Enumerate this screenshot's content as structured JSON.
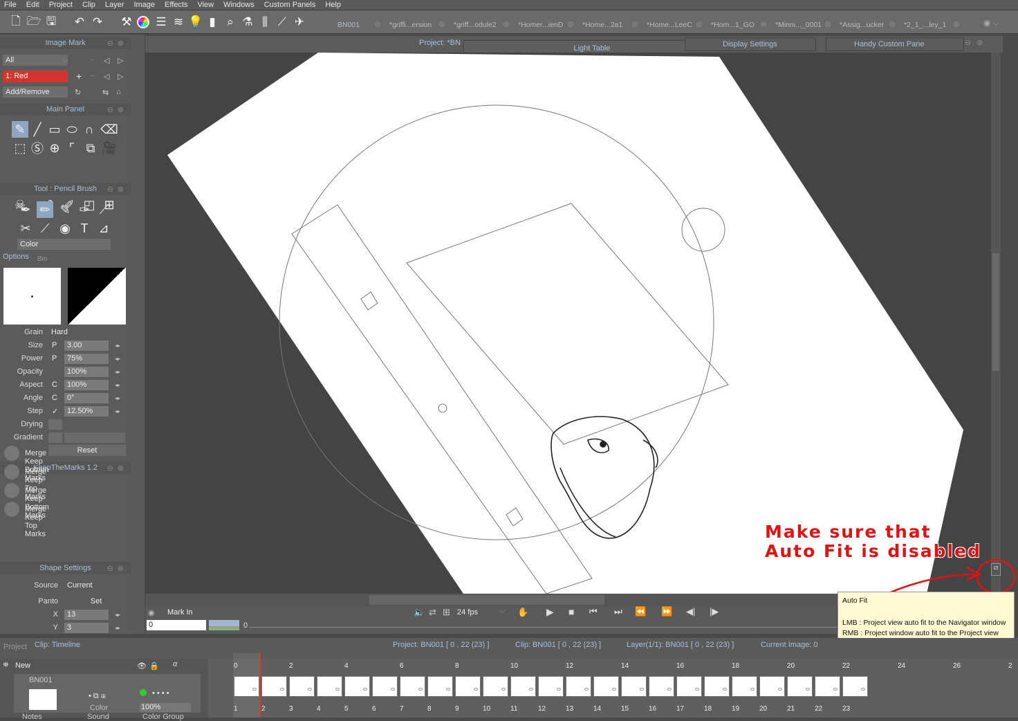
{
  "menu": [
    "File",
    "Edit",
    "Project",
    "Clip",
    "Layer",
    "Image",
    "Effects",
    "View",
    "Windows",
    "Custom Panels",
    "Help"
  ],
  "tabs": [
    {
      "label": "BN001",
      "active": true
    },
    {
      "label": "*griffi...ersion"
    },
    {
      "label": "*griff...odule2"
    },
    {
      "label": "*Homer...ienD"
    },
    {
      "label": "*Home...2a1"
    },
    {
      "label": "*Home...LeeC"
    },
    {
      "label": "*Hom...1_GO"
    },
    {
      "label": "*Minni..._0001"
    },
    {
      "label": "*Assig...ucker"
    },
    {
      "label": "*2_1_...ley_1"
    }
  ],
  "image_mark": {
    "title": "Image Mark",
    "filter": "All",
    "mark": "1: Red",
    "action": "Add/Remove",
    "mark_color": "#d2342e"
  },
  "main_panel": {
    "title": "Main Panel"
  },
  "tool_panel": {
    "title": "Tool : Pencil Brush",
    "color_label": "Color",
    "tab_options": "Options",
    "tab_bin": "Bin"
  },
  "brush": {
    "grain_label": "Grain",
    "grain": "Hard",
    "size_label": "Size",
    "size_flag": "P",
    "size": "3.00",
    "power_label": "Power",
    "power_flag": "P",
    "power": "75%",
    "opacity_label": "Opacity",
    "opacity": "100%",
    "aspect_label": "Aspect",
    "aspect_flag": "C",
    "aspect": "100%",
    "angle_label": "Angle",
    "angle_flag": "C",
    "angle": "0°",
    "step_label": "Step",
    "step": "12.50%",
    "drying_label": "Drying",
    "gradient_label": "Gradient",
    "reset_label": "Reset"
  },
  "keepthemarks": {
    "title": "KeepTheMarks 1.2",
    "items": [
      "Merge Keep Bottom Marks",
      "Merge Keep Top Marks",
      "Merge Keep Bottom Marks",
      "Merge Keep Top Marks"
    ]
  },
  "shape_settings": {
    "title": "Shape Settings",
    "source_label": "Source",
    "source": "Current",
    "panto_label": "Panto",
    "set_label": "Set",
    "x_label": "X",
    "x": "13",
    "y_label": "Y",
    "y": "3"
  },
  "view_header": {
    "project": "Project: *BN",
    "light_table": "Light Table",
    "display_settings": "Display Settings",
    "handy": "Handy Custom Pane"
  },
  "transport": {
    "mark_in": "Mark In",
    "frame_value": "0",
    "fps": "24 fps",
    "slider_start": "0"
  },
  "tooltip": {
    "title": "Auto Fit",
    "lmb": "LMB : Project view auto fit to the Navigator window",
    "rmb": "RMB : Project window auto fit to the Project view"
  },
  "annotation": {
    "line1": "Make sure that",
    "line2": "Auto Fit is disabled",
    "color": "#e31212"
  },
  "status": {
    "tab_project": "Project",
    "tab_clip": "Clip: Timeline",
    "project": "Project: BN001 [ 0 , 22  (23) ]",
    "clip": "Clip: BN001 [ 0 , 22  (23) ]",
    "layer": "Layer(1/1): BN001 [ 0 , 22  (23) ]",
    "current": "Current Image: 0"
  },
  "timeline": {
    "new_label": "New",
    "layer_name": "BN001",
    "color_label": "Color",
    "opacity": "100%",
    "notes": "Notes",
    "sound": "Sound",
    "color_group": "Color Group",
    "top_ticks": [
      "0",
      "2",
      "4",
      "6",
      "8",
      "10",
      "12",
      "14",
      "16",
      "18",
      "20",
      "22",
      "24",
      "26",
      "2"
    ],
    "bottom_ticks": [
      "1",
      "2",
      "3",
      "4",
      "5",
      "6",
      "7",
      "8",
      "9",
      "10",
      "11",
      "12",
      "13",
      "14",
      "15",
      "16",
      "17",
      "18",
      "19",
      "20",
      "21",
      "22",
      "23"
    ],
    "frame_count": 23
  }
}
